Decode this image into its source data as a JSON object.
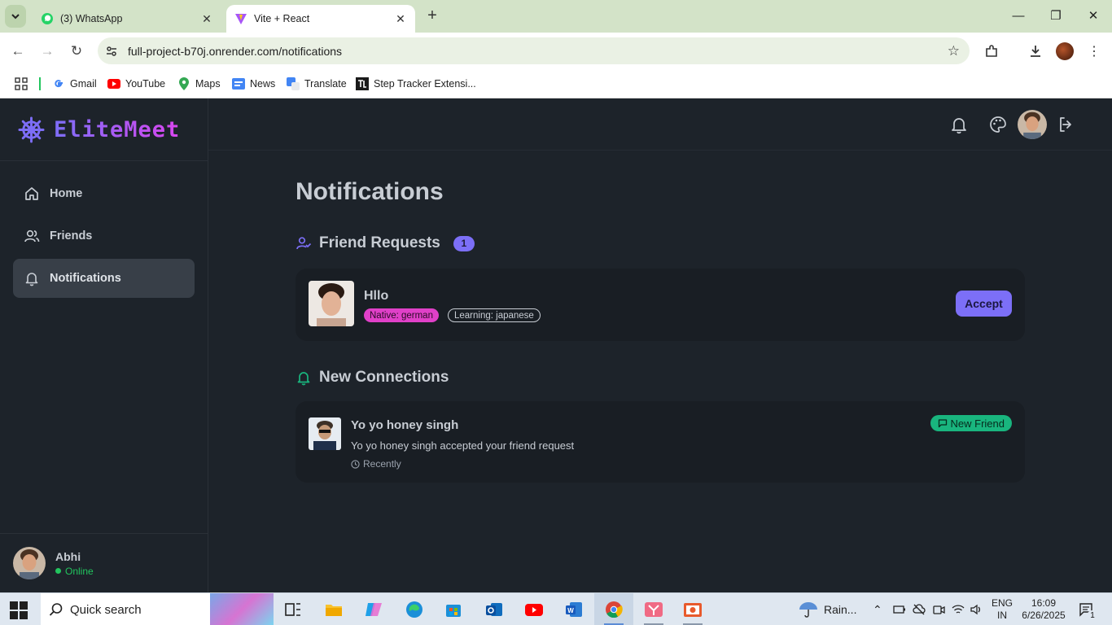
{
  "browser": {
    "tabs": [
      {
        "title": "(3) WhatsApp",
        "active": false
      },
      {
        "title": "Vite + React",
        "active": true
      }
    ],
    "url": "full-project-b70j.onrender.com/notifications",
    "bookmarks": [
      "Gmail",
      "YouTube",
      "Maps",
      "News",
      "Translate",
      "Step Tracker Extensi..."
    ]
  },
  "app": {
    "brand": "EliteMeet",
    "nav": [
      {
        "label": "Home",
        "icon": "home-icon",
        "active": false
      },
      {
        "label": "Friends",
        "icon": "users-icon",
        "active": false
      },
      {
        "label": "Notifications",
        "icon": "bell-icon",
        "active": true
      }
    ],
    "user": {
      "name": "Abhi",
      "status": "Online"
    }
  },
  "page": {
    "title": "Notifications",
    "friend_requests": {
      "heading": "Friend Requests",
      "count": "1",
      "items": [
        {
          "name": "Hllo",
          "native": "Native: german",
          "learning": "Learning: japanese",
          "action": "Accept"
        }
      ]
    },
    "new_connections": {
      "heading": "New Connections",
      "items": [
        {
          "name": "Yo yo honey singh",
          "message": "Yo yo honey singh accepted your friend request",
          "time": "Recently",
          "badge": "New Friend"
        }
      ]
    }
  },
  "taskbar": {
    "search": "Quick search",
    "weather": "Rain...",
    "lang_top": "ENG",
    "lang_bottom": "IN",
    "time": "16:09",
    "date": "6/26/2025",
    "notif_count": "1"
  },
  "colors": {
    "accent": "#7c6ff7",
    "native_tag": "#e040c8",
    "new_friend": "#19b57e",
    "background": "#1d232a",
    "card": "#191e24"
  }
}
